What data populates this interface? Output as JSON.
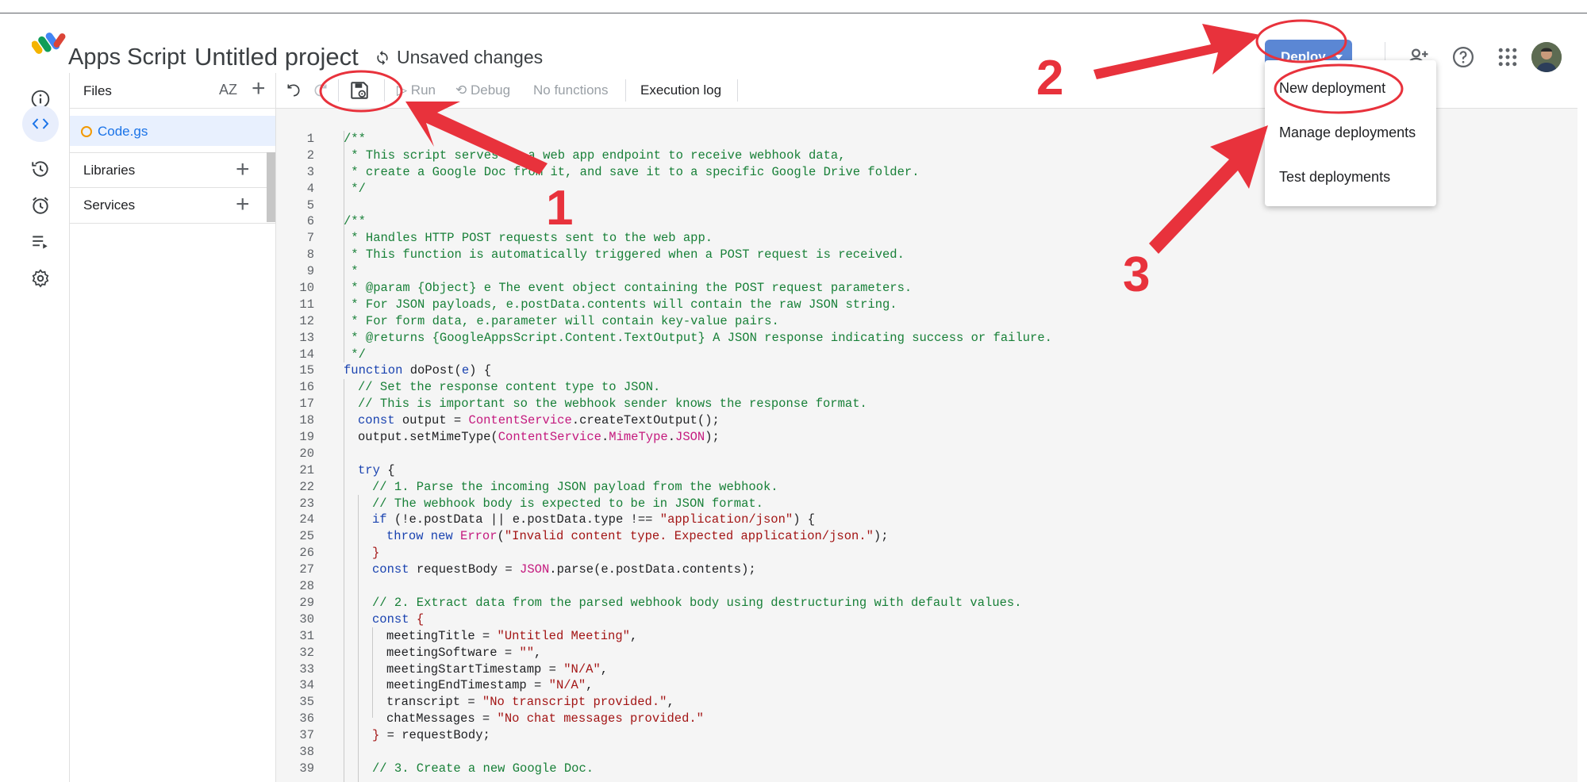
{
  "header": {
    "app_name": "Apps Script",
    "project_title": "Untitled project",
    "status": "Unsaved changes",
    "deploy_label": "Deploy",
    "icons": [
      "add-person-icon",
      "help-icon",
      "apps-grid-icon"
    ]
  },
  "deploy_menu": {
    "items": [
      "New deployment",
      "Manage deployments",
      "Test deployments"
    ]
  },
  "rail": {
    "icons": [
      "info-icon",
      "code-icon",
      "history-icon",
      "alarm-icon",
      "executions-icon",
      "settings-icon"
    ]
  },
  "files_panel": {
    "title": "Files",
    "sort_label": "AZ",
    "file": "Code.gs",
    "sections": [
      "Libraries",
      "Services"
    ]
  },
  "toolbar": {
    "run": "Run",
    "debug": "Debug",
    "functions": "No functions",
    "execution_log": "Execution log"
  },
  "annotations": {
    "labels": [
      "1",
      "2",
      "3"
    ]
  },
  "code": {
    "lines": [
      {
        "n": "1",
        "indent": 0,
        "parts": [
          {
            "t": "/**",
            "c": "com"
          }
        ]
      },
      {
        "n": "2",
        "indent": 0,
        "parts": [
          {
            "t": " * This script serves as a web app endpoint to receive webhook data,",
            "c": "com"
          }
        ]
      },
      {
        "n": "3",
        "indent": 0,
        "parts": [
          {
            "t": " * create a Google Doc from it, and save it to a specific Google Drive folder.",
            "c": "com"
          }
        ]
      },
      {
        "n": "4",
        "indent": 0,
        "parts": [
          {
            "t": " */",
            "c": "com"
          }
        ]
      },
      {
        "n": "5",
        "indent": 0,
        "parts": []
      },
      {
        "n": "6",
        "indent": 0,
        "parts": [
          {
            "t": "/**",
            "c": "com"
          }
        ]
      },
      {
        "n": "7",
        "indent": 0,
        "parts": [
          {
            "t": " * Handles HTTP POST requests sent to the web app.",
            "c": "com"
          }
        ]
      },
      {
        "n": "8",
        "indent": 0,
        "parts": [
          {
            "t": " * This function is automatically triggered when a POST request is received.",
            "c": "com"
          }
        ]
      },
      {
        "n": "9",
        "indent": 0,
        "parts": [
          {
            "t": " *",
            "c": "com"
          }
        ]
      },
      {
        "n": "10",
        "indent": 0,
        "parts": [
          {
            "t": " * @param {Object} e The event object containing the POST request parameters.",
            "c": "com"
          }
        ]
      },
      {
        "n": "11",
        "indent": 0,
        "parts": [
          {
            "t": " * For JSON payloads, e.postData.contents will contain the raw JSON string.",
            "c": "com"
          }
        ]
      },
      {
        "n": "12",
        "indent": 0,
        "parts": [
          {
            "t": " * For form data, e.parameter will contain key-value pairs.",
            "c": "com"
          }
        ]
      },
      {
        "n": "13",
        "indent": 0,
        "parts": [
          {
            "t": " * @returns {GoogleAppsScript.Content.TextOutput} A JSON response indicating success or failure.",
            "c": "com"
          }
        ]
      },
      {
        "n": "14",
        "indent": 0,
        "parts": [
          {
            "t": " */",
            "c": "com"
          }
        ]
      },
      {
        "n": "15",
        "indent": 0,
        "parts": [
          {
            "t": "function ",
            "c": "kw"
          },
          {
            "t": "doPost",
            "c": "fn"
          },
          {
            "t": "(",
            "c": "fn"
          },
          {
            "t": "e",
            "c": "kw"
          },
          {
            "t": ") {",
            "c": "fn"
          }
        ]
      },
      {
        "n": "16",
        "indent": 1,
        "parts": [
          {
            "t": "// Set the response content type to JSON.",
            "c": "com"
          }
        ]
      },
      {
        "n": "17",
        "indent": 1,
        "parts": [
          {
            "t": "// This is important so the webhook sender knows the response format.",
            "c": "com"
          }
        ]
      },
      {
        "n": "18",
        "indent": 1,
        "parts": [
          {
            "t": "const ",
            "c": "kw"
          },
          {
            "t": "output = ",
            "c": "fn"
          },
          {
            "t": "ContentService",
            "c": "cls"
          },
          {
            "t": ".createTextOutput();",
            "c": "fn"
          }
        ]
      },
      {
        "n": "19",
        "indent": 1,
        "parts": [
          {
            "t": "output.setMimeType(",
            "c": "fn"
          },
          {
            "t": "ContentService",
            "c": "cls"
          },
          {
            "t": ".",
            "c": "fn"
          },
          {
            "t": "MimeType",
            "c": "cls"
          },
          {
            "t": ".",
            "c": "fn"
          },
          {
            "t": "JSON",
            "c": "cls"
          },
          {
            "t": ");",
            "c": "fn"
          }
        ]
      },
      {
        "n": "20",
        "indent": 0,
        "parts": []
      },
      {
        "n": "21",
        "indent": 1,
        "parts": [
          {
            "t": "try ",
            "c": "kw"
          },
          {
            "t": "{",
            "c": "fn"
          }
        ]
      },
      {
        "n": "22",
        "indent": 2,
        "parts": [
          {
            "t": "// 1. Parse the incoming JSON payload from the webhook.",
            "c": "com"
          }
        ]
      },
      {
        "n": "23",
        "indent": 2,
        "parts": [
          {
            "t": "// The webhook body is expected to be in JSON format.",
            "c": "com"
          }
        ]
      },
      {
        "n": "24",
        "indent": 2,
        "parts": [
          {
            "t": "if ",
            "c": "kw"
          },
          {
            "t": "(!e.postData || e.postData.type !== ",
            "c": "fn"
          },
          {
            "t": "\"application/json\"",
            "c": "str"
          },
          {
            "t": ") {",
            "c": "fn"
          }
        ]
      },
      {
        "n": "25",
        "indent": 3,
        "parts": [
          {
            "t": "throw new ",
            "c": "kw"
          },
          {
            "t": "Error",
            "c": "cls"
          },
          {
            "t": "(",
            "c": "fn"
          },
          {
            "t": "\"Invalid content type. Expected application/json.\"",
            "c": "str"
          },
          {
            "t": ");",
            "c": "fn"
          }
        ]
      },
      {
        "n": "26",
        "indent": 2,
        "parts": [
          {
            "t": "}",
            "c": "str"
          }
        ]
      },
      {
        "n": "27",
        "indent": 2,
        "parts": [
          {
            "t": "const ",
            "c": "kw"
          },
          {
            "t": "requestBody = ",
            "c": "fn"
          },
          {
            "t": "JSON",
            "c": "cls"
          },
          {
            "t": ".parse(e.postData.contents);",
            "c": "fn"
          }
        ]
      },
      {
        "n": "28",
        "indent": 0,
        "parts": []
      },
      {
        "n": "29",
        "indent": 2,
        "parts": [
          {
            "t": "// 2. Extract data from the parsed webhook body using destructuring with default values.",
            "c": "com"
          }
        ]
      },
      {
        "n": "30",
        "indent": 2,
        "parts": [
          {
            "t": "const ",
            "c": "kw"
          },
          {
            "t": "{",
            "c": "str"
          }
        ]
      },
      {
        "n": "31",
        "indent": 3,
        "parts": [
          {
            "t": "meetingTitle = ",
            "c": "fn"
          },
          {
            "t": "\"Untitled Meeting\"",
            "c": "str"
          },
          {
            "t": ",",
            "c": "fn"
          }
        ]
      },
      {
        "n": "32",
        "indent": 3,
        "parts": [
          {
            "t": "meetingSoftware = ",
            "c": "fn"
          },
          {
            "t": "\"\"",
            "c": "str"
          },
          {
            "t": ",",
            "c": "fn"
          }
        ]
      },
      {
        "n": "33",
        "indent": 3,
        "parts": [
          {
            "t": "meetingStartTimestamp = ",
            "c": "fn"
          },
          {
            "t": "\"N/A\"",
            "c": "str"
          },
          {
            "t": ",",
            "c": "fn"
          }
        ]
      },
      {
        "n": "34",
        "indent": 3,
        "parts": [
          {
            "t": "meetingEndTimestamp = ",
            "c": "fn"
          },
          {
            "t": "\"N/A\"",
            "c": "str"
          },
          {
            "t": ",",
            "c": "fn"
          }
        ]
      },
      {
        "n": "35",
        "indent": 3,
        "parts": [
          {
            "t": "transcript = ",
            "c": "fn"
          },
          {
            "t": "\"No transcript provided.\"",
            "c": "str"
          },
          {
            "t": ",",
            "c": "fn"
          }
        ]
      },
      {
        "n": "36",
        "indent": 3,
        "parts": [
          {
            "t": "chatMessages = ",
            "c": "fn"
          },
          {
            "t": "\"No chat messages provided.\"",
            "c": "str"
          }
        ]
      },
      {
        "n": "37",
        "indent": 2,
        "parts": [
          {
            "t": "}",
            "c": "str"
          },
          {
            "t": " = requestBody;",
            "c": "fn"
          }
        ]
      },
      {
        "n": "38",
        "indent": 0,
        "parts": []
      },
      {
        "n": "39",
        "indent": 2,
        "parts": [
          {
            "t": "// 3. Create a new Google Doc.",
            "c": "com"
          }
        ]
      }
    ]
  }
}
